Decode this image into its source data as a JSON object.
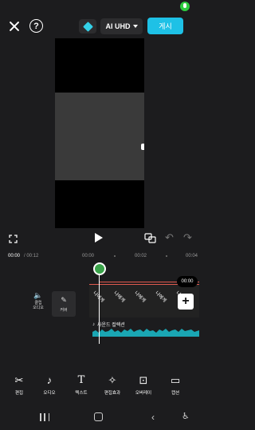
{
  "header": {
    "quality_label": "AI UHD",
    "post_label": "게시"
  },
  "colors": {
    "accent": "#1ec1e6",
    "gem": "#34d1e8",
    "playhead_green": "#3aa34a",
    "mic_green": "#2ecc40",
    "waveform": "#1aa6b3",
    "marker_red": "#e05a4f"
  },
  "timecode": {
    "current": "00:00",
    "total": "/ 00:12",
    "ticks": [
      "00:00",
      "00:02",
      "00:04"
    ]
  },
  "timeline": {
    "audio_tool_label": "클립\n오디오",
    "cover_label": "커버",
    "clip_labels": [
      "나에게",
      "나에게",
      "나에게",
      "나에게",
      "나에게"
    ],
    "time_bubble": "00:00",
    "sound_label": "사운드 컬렉션"
  },
  "toolbar": {
    "items": [
      {
        "label": "편집",
        "icon": "scissors-icon"
      },
      {
        "label": "오디오",
        "icon": "music-note-icon"
      },
      {
        "label": "텍스트",
        "icon": "text-icon"
      },
      {
        "label": "편집효과",
        "icon": "sparkle-icon"
      },
      {
        "label": "오버레이",
        "icon": "overlay-icon"
      },
      {
        "label": "캡션",
        "icon": "caption-icon"
      }
    ]
  }
}
